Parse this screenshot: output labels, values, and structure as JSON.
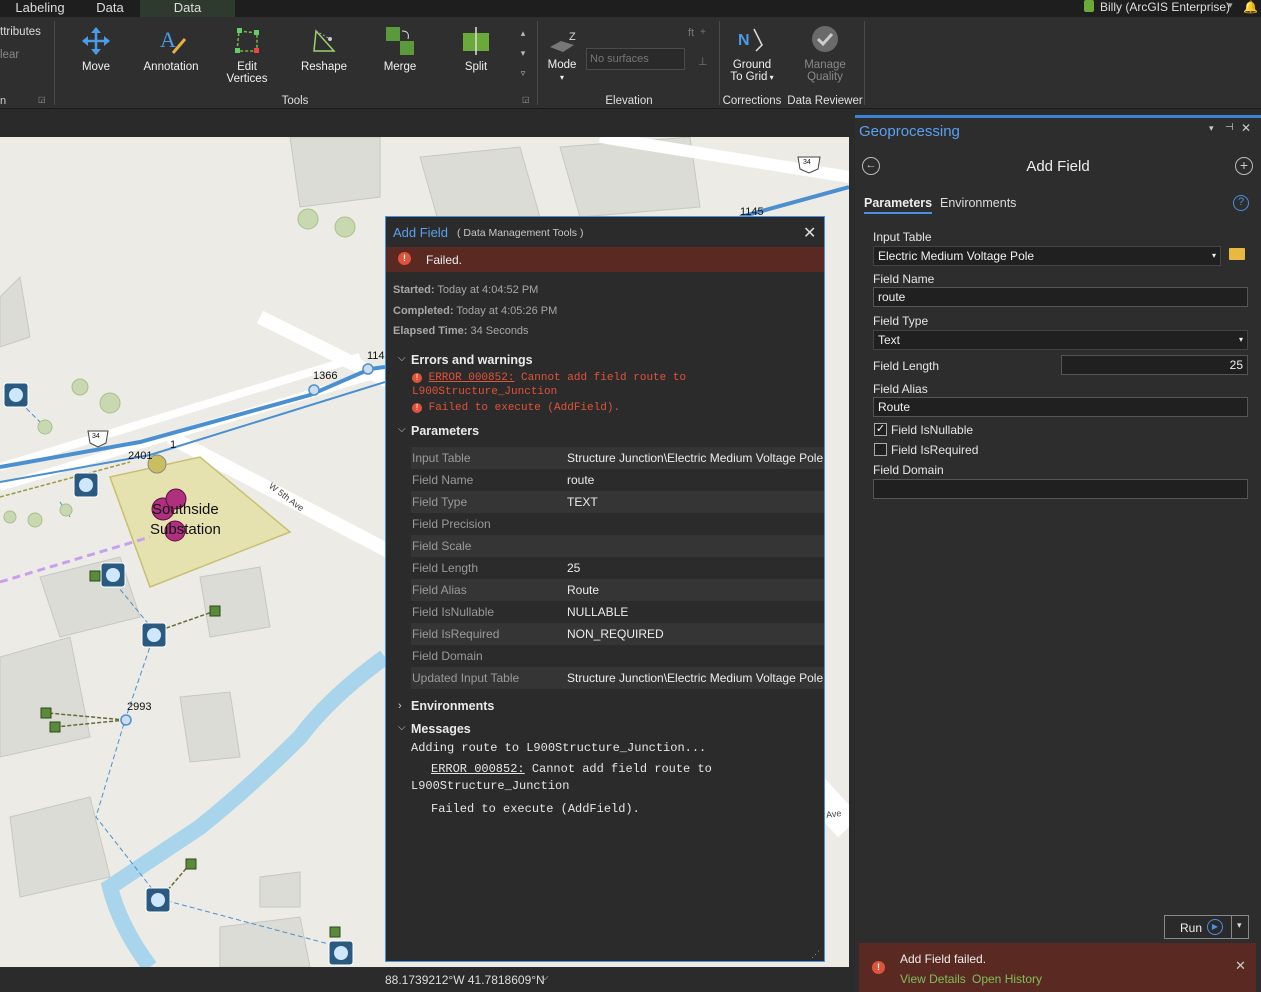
{
  "tabs": [
    "Labeling",
    "Data",
    "Data"
  ],
  "user": "Billy (ArcGIS Enterprise)",
  "ribbon": {
    "left_fragment_1": "ttributes",
    "left_fragment_2": "lear",
    "tools": [
      "Move",
      "Annotation",
      "Edit Vertices",
      "Reshape",
      "Merge",
      "Split"
    ],
    "edit_vertices_l1": "Edit",
    "edit_vertices_l2": "Vertices",
    "tools_group": "Tools",
    "mode": "Mode",
    "surface_placeholder": "No surfaces",
    "ft": "ft",
    "elevation_group": "Elevation",
    "ground_l1": "Ground",
    "ground_l2": "To Grid",
    "corrections_group": "Corrections",
    "manage_l1": "Manage",
    "manage_l2": "Quality",
    "reviewer_group": "Data Reviewer"
  },
  "map": {
    "labels": [
      "1145",
      "114",
      "1366",
      "2401",
      "1",
      "Southside",
      "Substation",
      "W 5th Ave",
      "2993",
      "Ave",
      "34",
      "34"
    ],
    "coordinates": "88.1739212°W 41.7818609°N"
  },
  "popup": {
    "title": "Add Field",
    "subtitle": "( Data Management Tools )",
    "status": "Failed.",
    "started_label": "Started:",
    "started": "Today at 4:04:52 PM",
    "completed_label": "Completed:",
    "completed": "Today at 4:05:26 PM",
    "elapsed_label": "Elapsed Time:",
    "elapsed": "34 Seconds",
    "errors_header": "Errors and warnings",
    "error_code": "ERROR 000852:",
    "error_text": " Cannot add field route to",
    "error_text2": "L900Structure_Junction",
    "error_text3": "Failed to execute (AddField).",
    "params_header": "Parameters",
    "params": [
      {
        "k": "Input Table",
        "v": "Structure Junction\\Electric Medium Voltage Pole"
      },
      {
        "k": "Field Name",
        "v": "route"
      },
      {
        "k": "Field Type",
        "v": "TEXT"
      },
      {
        "k": "Field Precision",
        "v": ""
      },
      {
        "k": "Field Scale",
        "v": ""
      },
      {
        "k": "Field Length",
        "v": "25"
      },
      {
        "k": "Field Alias",
        "v": "Route"
      },
      {
        "k": "Field IsNullable",
        "v": "NULLABLE"
      },
      {
        "k": "Field IsRequired",
        "v": "NON_REQUIRED"
      },
      {
        "k": "Field Domain",
        "v": ""
      },
      {
        "k": "Updated Input Table",
        "v": "Structure Junction\\Electric Medium Voltage Pole"
      }
    ],
    "env_header": "Environments",
    "msg_header": "Messages",
    "msg1": "Adding route to L900Structure_Junction...",
    "msg2_code": "ERROR 000852:",
    "msg2": " Cannot add field route to",
    "msg3": "L900Structure_Junction",
    "msg4": "Failed to execute (AddField)."
  },
  "gp": {
    "pane_title": "Geoprocessing",
    "tool_title": "Add Field",
    "tab_params": "Parameters",
    "tab_env": "Environments",
    "input_table_label": "Input Table",
    "input_table": "Electric Medium Voltage Pole",
    "field_name_label": "Field Name",
    "field_name": "route",
    "field_type_label": "Field Type",
    "field_type": "Text",
    "field_length_label": "Field Length",
    "field_length": "25",
    "field_alias_label": "Field Alias",
    "field_alias": "Route",
    "nullable_label": "Field IsNullable",
    "required_label": "Field IsRequired",
    "domain_label": "Field Domain",
    "run": "Run",
    "notify_title": "Add Field failed.",
    "view_details": "View Details",
    "open_history": "Open History"
  },
  "colors": {
    "accent": "#4a90e2",
    "error": "#e0533b",
    "failed_bar": "#5a2a22",
    "title_blue": "#5aa0f0",
    "link_green": "#7fbf5a"
  }
}
